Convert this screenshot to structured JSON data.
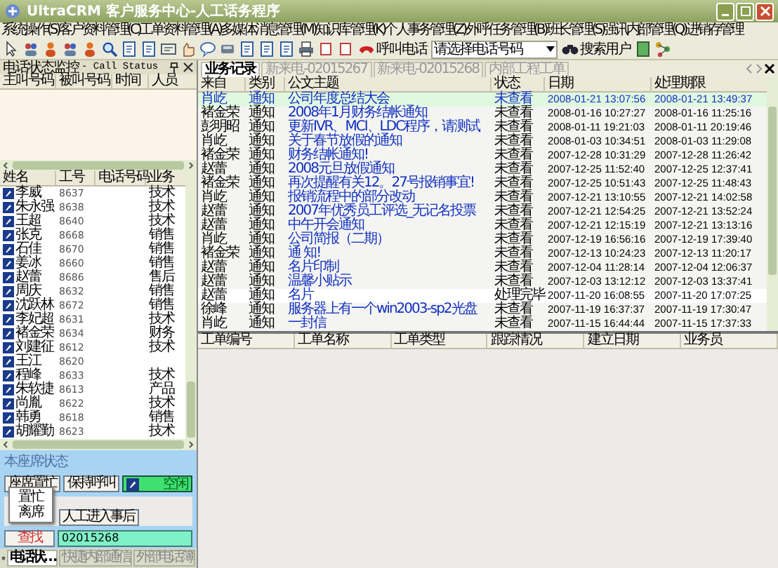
{
  "window": {
    "title": "UltraCRM 客户服务中心-人工话务程序"
  },
  "menu": [
    "系统操作(S)",
    "客户资料管理(C)",
    "工单资料管理(A)",
    "多媒体消息管理(M)",
    "知识库管理(K)",
    "个人事务管理(Z)",
    "外呼任务管理(B)",
    "班长管理(S)",
    "强讯内部管理(Q)",
    "进销存管理"
  ],
  "toolbar": {
    "call_button": "呼叫电话",
    "phone_select": {
      "placeholder": "请选择电话号码"
    },
    "search_button": "搜索用户"
  },
  "call_status": {
    "title": "电话状态监控",
    "subtitle": "- Call Status",
    "columns": [
      "主叫号码",
      "被叫号码",
      "时间",
      "人员"
    ]
  },
  "staff": {
    "columns": [
      "姓名",
      "工号",
      "电话号码",
      "业务"
    ],
    "rows": [
      {
        "name": "李威",
        "id": "8637",
        "dept": "技术"
      },
      {
        "name": "朱永强",
        "id": "8638",
        "dept": "技术"
      },
      {
        "name": "王超",
        "id": "8640",
        "dept": "技术"
      },
      {
        "name": "张克",
        "id": "8668",
        "dept": "销售"
      },
      {
        "name": "石佳",
        "id": "8670",
        "dept": "销售"
      },
      {
        "name": "姜冰",
        "id": "8660",
        "dept": "销售"
      },
      {
        "name": "赵蕾",
        "id": "8686",
        "dept": "售后"
      },
      {
        "name": "周庆",
        "id": "8632",
        "dept": "销售"
      },
      {
        "name": "沈跃林",
        "id": "8672",
        "dept": "销售"
      },
      {
        "name": "李妃超",
        "id": "8631",
        "dept": "技术"
      },
      {
        "name": "褚金荣",
        "id": "8634",
        "dept": "财务"
      },
      {
        "name": "刘建征",
        "id": "8612",
        "dept": "技术"
      },
      {
        "name": "王江",
        "id": "8620",
        "dept": ""
      },
      {
        "name": "程峰",
        "id": "8633",
        "dept": "技术"
      },
      {
        "name": "朱软捷",
        "id": "8613",
        "dept": "产品"
      },
      {
        "name": "尚胤",
        "id": "8622",
        "dept": "技术"
      },
      {
        "name": "韩勇",
        "id": "8618",
        "dept": "销售"
      },
      {
        "name": "胡耀勤",
        "id": "8623",
        "dept": "技术"
      }
    ]
  },
  "agent": {
    "title": "本座席状态",
    "busy_button": "座席置忙",
    "hold_button": "保持呼叫",
    "state": "空闲",
    "after_call_button": "人工进入事后",
    "find_button": "查找",
    "number": "02015268",
    "popup": [
      "置忙",
      "离席"
    ]
  },
  "bottom_tabs": [
    {
      "label": "电话状…",
      "selected": true
    },
    {
      "label": "快捷内部通信",
      "selected": false
    },
    {
      "label": "外部电话簿",
      "selected": false
    }
  ],
  "tabs": [
    {
      "label": "业务记录",
      "selected": true
    },
    {
      "label": "新来电-02015267",
      "selected": false
    },
    {
      "label": "新来电-02015268",
      "selected": false
    },
    {
      "label": "内部工程工单",
      "selected": false
    }
  ],
  "records": {
    "columns": [
      "来自",
      "类别",
      "公文主题",
      "状态",
      "日期",
      "处理期限"
    ],
    "rows": [
      {
        "from": "肖屹",
        "type": "通知",
        "subject": "公司年度总结大会",
        "status": "未查看",
        "date": "2008-01-21 13:07:56",
        "deadline": "2008-01-21 13:49:37",
        "selected": true,
        "read": false
      },
      {
        "from": "褚金荣",
        "type": "通知",
        "subject": "2008年1月财务结帐通知",
        "status": "未查看",
        "date": "2008-01-16 10:27:27",
        "deadline": "2008-01-16 11:25:16",
        "selected": false,
        "read": false
      },
      {
        "from": "彭明昭",
        "type": "通知",
        "subject": "更新IVR、MCI、LDC程序，请测试",
        "status": "未查看",
        "date": "2008-01-11 19:21:03",
        "deadline": "2008-01-11 20:19:46",
        "selected": false,
        "read": false
      },
      {
        "from": "肖屹",
        "type": "通知",
        "subject": "关于春节放假的通知",
        "status": "未查看",
        "date": "2008-01-03 10:34:51",
        "deadline": "2008-01-03 11:29:08",
        "selected": false,
        "read": false
      },
      {
        "from": "褚金荣",
        "type": "通知",
        "subject": "财务结帐通知!",
        "status": "未查看",
        "date": "2007-12-28 10:31:29",
        "deadline": "2007-12-28 11:26:42",
        "selected": false,
        "read": false
      },
      {
        "from": "赵蕾",
        "type": "通知",
        "subject": "2008元旦放假通知",
        "status": "未查看",
        "date": "2007-12-25 11:52:40",
        "deadline": "2007-12-25 12:37:41",
        "selected": false,
        "read": false
      },
      {
        "from": "褚金荣",
        "type": "通知",
        "subject": "再次提醒有关12。27号报销事宜!",
        "status": "未查看",
        "date": "2007-12-25 10:51:43",
        "deadline": "2007-12-25 11:48:43",
        "selected": false,
        "read": false
      },
      {
        "from": "肖屹",
        "type": "通知",
        "subject": "报销流程中的部分改动",
        "status": "未查看",
        "date": "2007-12-21 13:10:55",
        "deadline": "2007-12-21 14:02:58",
        "selected": false,
        "read": false
      },
      {
        "from": "赵蕾",
        "type": "通知",
        "subject": "2007年优秀员工评选_无记名投票",
        "status": "未查看",
        "date": "2007-12-21 12:54:25",
        "deadline": "2007-12-21 13:52:24",
        "selected": false,
        "read": false
      },
      {
        "from": "赵蕾",
        "type": "通知",
        "subject": "中午开会通知",
        "status": "未查看",
        "date": "2007-12-21 12:15:19",
        "deadline": "2007-12-21 13:13:16",
        "selected": false,
        "read": false
      },
      {
        "from": "肖屹",
        "type": "通知",
        "subject": "公司简报（二期）",
        "status": "未查看",
        "date": "2007-12-19 16:56:16",
        "deadline": "2007-12-19 17:39:40",
        "selected": false,
        "read": false
      },
      {
        "from": "褚金荣",
        "type": "通知",
        "subject": "通 知!",
        "status": "未查看",
        "date": "2007-12-13 10:24:23",
        "deadline": "2007-12-13 11:20:17",
        "selected": false,
        "read": false
      },
      {
        "from": "赵蕾",
        "type": "通知",
        "subject": "名片印制",
        "status": "未查看",
        "date": "2007-12-04 11:28:14",
        "deadline": "2007-12-04 12:06:37",
        "selected": false,
        "read": false
      },
      {
        "from": "赵蕾",
        "type": "通知",
        "subject": "温馨小贴示",
        "status": "未查看",
        "date": "2007-12-03 13:12:12",
        "deadline": "2007-12-03 13:37:41",
        "selected": false,
        "read": false
      },
      {
        "from": "赵蕾",
        "type": "通知",
        "subject": "名片",
        "status": "处理完毕",
        "date": "2007-11-20 16:08:55",
        "deadline": "2007-11-20 17:07:25",
        "selected": false,
        "read": true
      },
      {
        "from": "徐峰",
        "type": "通知",
        "subject": "服务器上有一个win2003-sp2光盘",
        "status": "未查看",
        "date": "2007-11-19 16:37:37",
        "deadline": "2007-11-19 17:30:47",
        "selected": false,
        "read": false
      },
      {
        "from": "肖屹",
        "type": "通知",
        "subject": "一封信",
        "status": "未查看",
        "date": "2007-11-15 16:44:44",
        "deadline": "2007-11-15 17:37:33",
        "selected": false,
        "read": false
      }
    ]
  },
  "work_orders": {
    "columns": [
      "工单编号",
      "工单名称",
      "工单类型",
      "跟踪情况",
      "建立日期",
      "业务员"
    ]
  }
}
